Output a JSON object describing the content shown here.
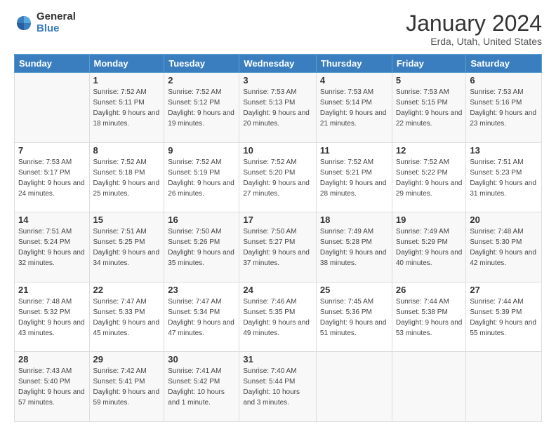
{
  "logo": {
    "general": "General",
    "blue": "Blue"
  },
  "header": {
    "month_year": "January 2024",
    "location": "Erda, Utah, United States"
  },
  "days_of_week": [
    "Sunday",
    "Monday",
    "Tuesday",
    "Wednesday",
    "Thursday",
    "Friday",
    "Saturday"
  ],
  "weeks": [
    [
      {
        "day": "",
        "sunrise": "",
        "sunset": "",
        "daylight": ""
      },
      {
        "day": "1",
        "sunrise": "Sunrise: 7:52 AM",
        "sunset": "Sunset: 5:11 PM",
        "daylight": "Daylight: 9 hours and 18 minutes."
      },
      {
        "day": "2",
        "sunrise": "Sunrise: 7:52 AM",
        "sunset": "Sunset: 5:12 PM",
        "daylight": "Daylight: 9 hours and 19 minutes."
      },
      {
        "day": "3",
        "sunrise": "Sunrise: 7:53 AM",
        "sunset": "Sunset: 5:13 PM",
        "daylight": "Daylight: 9 hours and 20 minutes."
      },
      {
        "day": "4",
        "sunrise": "Sunrise: 7:53 AM",
        "sunset": "Sunset: 5:14 PM",
        "daylight": "Daylight: 9 hours and 21 minutes."
      },
      {
        "day": "5",
        "sunrise": "Sunrise: 7:53 AM",
        "sunset": "Sunset: 5:15 PM",
        "daylight": "Daylight: 9 hours and 22 minutes."
      },
      {
        "day": "6",
        "sunrise": "Sunrise: 7:53 AM",
        "sunset": "Sunset: 5:16 PM",
        "daylight": "Daylight: 9 hours and 23 minutes."
      }
    ],
    [
      {
        "day": "7",
        "sunrise": "Sunrise: 7:53 AM",
        "sunset": "Sunset: 5:17 PM",
        "daylight": "Daylight: 9 hours and 24 minutes."
      },
      {
        "day": "8",
        "sunrise": "Sunrise: 7:52 AM",
        "sunset": "Sunset: 5:18 PM",
        "daylight": "Daylight: 9 hours and 25 minutes."
      },
      {
        "day": "9",
        "sunrise": "Sunrise: 7:52 AM",
        "sunset": "Sunset: 5:19 PM",
        "daylight": "Daylight: 9 hours and 26 minutes."
      },
      {
        "day": "10",
        "sunrise": "Sunrise: 7:52 AM",
        "sunset": "Sunset: 5:20 PM",
        "daylight": "Daylight: 9 hours and 27 minutes."
      },
      {
        "day": "11",
        "sunrise": "Sunrise: 7:52 AM",
        "sunset": "Sunset: 5:21 PM",
        "daylight": "Daylight: 9 hours and 28 minutes."
      },
      {
        "day": "12",
        "sunrise": "Sunrise: 7:52 AM",
        "sunset": "Sunset: 5:22 PM",
        "daylight": "Daylight: 9 hours and 29 minutes."
      },
      {
        "day": "13",
        "sunrise": "Sunrise: 7:51 AM",
        "sunset": "Sunset: 5:23 PM",
        "daylight": "Daylight: 9 hours and 31 minutes."
      }
    ],
    [
      {
        "day": "14",
        "sunrise": "Sunrise: 7:51 AM",
        "sunset": "Sunset: 5:24 PM",
        "daylight": "Daylight: 9 hours and 32 minutes."
      },
      {
        "day": "15",
        "sunrise": "Sunrise: 7:51 AM",
        "sunset": "Sunset: 5:25 PM",
        "daylight": "Daylight: 9 hours and 34 minutes."
      },
      {
        "day": "16",
        "sunrise": "Sunrise: 7:50 AM",
        "sunset": "Sunset: 5:26 PM",
        "daylight": "Daylight: 9 hours and 35 minutes."
      },
      {
        "day": "17",
        "sunrise": "Sunrise: 7:50 AM",
        "sunset": "Sunset: 5:27 PM",
        "daylight": "Daylight: 9 hours and 37 minutes."
      },
      {
        "day": "18",
        "sunrise": "Sunrise: 7:49 AM",
        "sunset": "Sunset: 5:28 PM",
        "daylight": "Daylight: 9 hours and 38 minutes."
      },
      {
        "day": "19",
        "sunrise": "Sunrise: 7:49 AM",
        "sunset": "Sunset: 5:29 PM",
        "daylight": "Daylight: 9 hours and 40 minutes."
      },
      {
        "day": "20",
        "sunrise": "Sunrise: 7:48 AM",
        "sunset": "Sunset: 5:30 PM",
        "daylight": "Daylight: 9 hours and 42 minutes."
      }
    ],
    [
      {
        "day": "21",
        "sunrise": "Sunrise: 7:48 AM",
        "sunset": "Sunset: 5:32 PM",
        "daylight": "Daylight: 9 hours and 43 minutes."
      },
      {
        "day": "22",
        "sunrise": "Sunrise: 7:47 AM",
        "sunset": "Sunset: 5:33 PM",
        "daylight": "Daylight: 9 hours and 45 minutes."
      },
      {
        "day": "23",
        "sunrise": "Sunrise: 7:47 AM",
        "sunset": "Sunset: 5:34 PM",
        "daylight": "Daylight: 9 hours and 47 minutes."
      },
      {
        "day": "24",
        "sunrise": "Sunrise: 7:46 AM",
        "sunset": "Sunset: 5:35 PM",
        "daylight": "Daylight: 9 hours and 49 minutes."
      },
      {
        "day": "25",
        "sunrise": "Sunrise: 7:45 AM",
        "sunset": "Sunset: 5:36 PM",
        "daylight": "Daylight: 9 hours and 51 minutes."
      },
      {
        "day": "26",
        "sunrise": "Sunrise: 7:44 AM",
        "sunset": "Sunset: 5:38 PM",
        "daylight": "Daylight: 9 hours and 53 minutes."
      },
      {
        "day": "27",
        "sunrise": "Sunrise: 7:44 AM",
        "sunset": "Sunset: 5:39 PM",
        "daylight": "Daylight: 9 hours and 55 minutes."
      }
    ],
    [
      {
        "day": "28",
        "sunrise": "Sunrise: 7:43 AM",
        "sunset": "Sunset: 5:40 PM",
        "daylight": "Daylight: 9 hours and 57 minutes."
      },
      {
        "day": "29",
        "sunrise": "Sunrise: 7:42 AM",
        "sunset": "Sunset: 5:41 PM",
        "daylight": "Daylight: 9 hours and 59 minutes."
      },
      {
        "day": "30",
        "sunrise": "Sunrise: 7:41 AM",
        "sunset": "Sunset: 5:42 PM",
        "daylight": "Daylight: 10 hours and 1 minute."
      },
      {
        "day": "31",
        "sunrise": "Sunrise: 7:40 AM",
        "sunset": "Sunset: 5:44 PM",
        "daylight": "Daylight: 10 hours and 3 minutes."
      },
      {
        "day": "",
        "sunrise": "",
        "sunset": "",
        "daylight": ""
      },
      {
        "day": "",
        "sunrise": "",
        "sunset": "",
        "daylight": ""
      },
      {
        "day": "",
        "sunrise": "",
        "sunset": "",
        "daylight": ""
      }
    ]
  ]
}
